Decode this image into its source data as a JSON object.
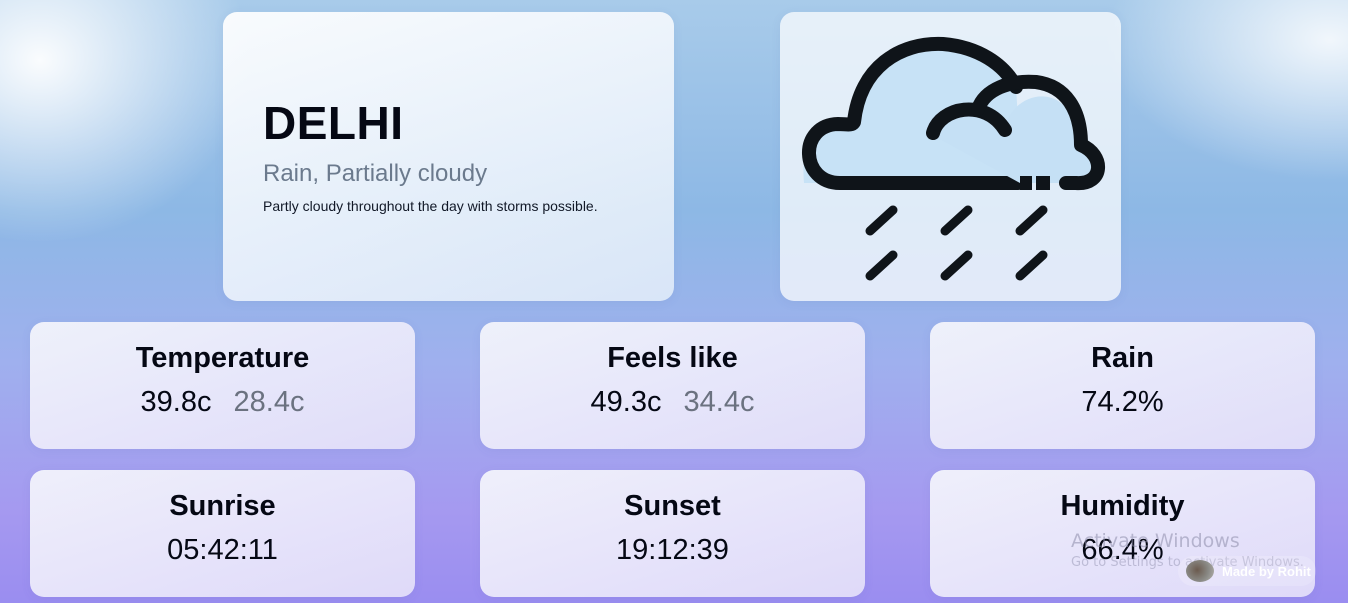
{
  "hero": {
    "city": "DELHI",
    "conditions": "Rain, Partially cloudy",
    "description": "Partly cloudy throughout the day with storms possible."
  },
  "weather_icon": "cloud-rain-icon",
  "stats": {
    "temperature": {
      "title": "Temperature",
      "max": "39.8c",
      "min": "28.4c"
    },
    "feels_like": {
      "title": "Feels like",
      "max": "49.3c",
      "min": "34.4c"
    },
    "rain": {
      "title": "Rain",
      "value": "74.2%"
    },
    "sunrise": {
      "title": "Sunrise",
      "value": "05:42:11"
    },
    "sunset": {
      "title": "Sunset",
      "value": "19:12:39"
    },
    "humidity": {
      "title": "Humidity",
      "value": "66.4%"
    }
  },
  "overlay": {
    "activate_title": "Activate Windows",
    "activate_sub": "Go to Settings to activate Windows.",
    "made_by": "Made by Rohit"
  },
  "colors": {
    "primary_text": "#050814",
    "secondary_text": "#6b7280",
    "muted_text": "#6b7a8d",
    "icon_stroke": "#0f1419",
    "icon_fill": "#c5e0f5"
  }
}
